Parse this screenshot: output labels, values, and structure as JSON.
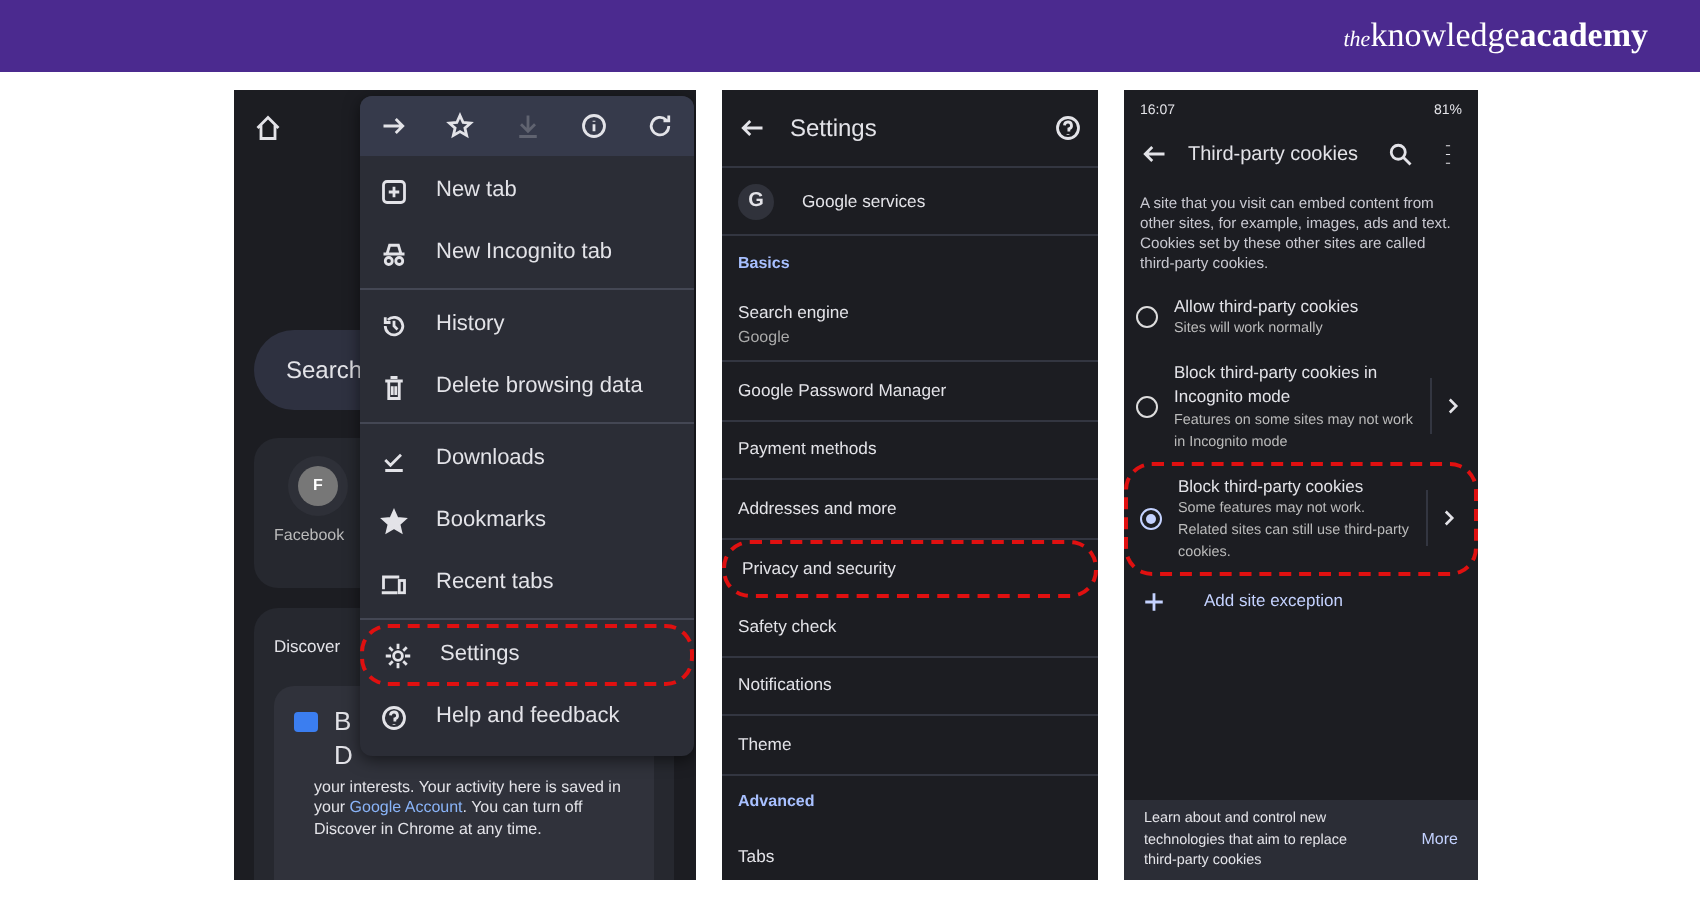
{
  "header": {
    "logo": [
      "the",
      "knowledge",
      "academy"
    ]
  },
  "menu_screen": {
    "search": "Search",
    "shortcut": {
      "letter": "F",
      "label": "Facebook"
    },
    "discover": {
      "title": "Discover",
      "card_letters": [
        "B",
        "D"
      ],
      "text": "your interests. Your activity here is saved in your **Google Account**. You can turn off Discover in Chrome at any time."
    },
    "toolbar": [
      {
        "kind": "forward",
        "disabled": false
      },
      {
        "kind": "star",
        "disabled": false
      },
      {
        "kind": "download",
        "disabled": true
      },
      {
        "kind": "info",
        "disabled": false
      },
      {
        "kind": "refresh",
        "disabled": false
      }
    ],
    "sections": [
      [
        {
          "kind": "new-tab",
          "label": "New tab",
          "highlighted": false
        },
        {
          "kind": "incognito",
          "label": "New Incognito tab",
          "highlighted": false
        }
      ],
      [
        {
          "kind": "history",
          "label": "History",
          "highlighted": false
        },
        {
          "kind": "delete",
          "label": "Delete browsing data",
          "highlighted": false
        }
      ],
      [
        {
          "kind": "downloads",
          "label": "Downloads",
          "highlighted": false
        },
        {
          "kind": "bookmarks",
          "label": "Bookmarks",
          "highlighted": false
        },
        {
          "kind": "recent",
          "label": "Recent tabs",
          "highlighted": false
        }
      ],
      [
        {
          "kind": "settings",
          "label": "Settings",
          "highlighted": true
        },
        {
          "kind": "help",
          "label": "Help and feedback",
          "highlighted": false
        }
      ]
    ]
  },
  "settings_screen": {
    "title": "Settings",
    "items": [
      {
        "kind": "account",
        "letter": "G",
        "label": "Google services",
        "highlighted": false
      },
      {
        "kind": "heading",
        "label": "Basics"
      },
      {
        "kind": "item",
        "label": "Search engine",
        "sub": "Google",
        "highlighted": false
      },
      {
        "kind": "item",
        "label": "Google Password Manager",
        "highlighted": false
      },
      {
        "kind": "item",
        "label": "Payment methods",
        "highlighted": false
      },
      {
        "kind": "item",
        "label": "Addresses and more",
        "highlighted": false
      },
      {
        "kind": "item",
        "label": "Privacy and security",
        "highlighted": true
      },
      {
        "kind": "item",
        "label": "Safety check",
        "highlighted": false
      },
      {
        "kind": "item",
        "label": "Notifications",
        "highlighted": false
      },
      {
        "kind": "item",
        "label": "Theme",
        "highlighted": false
      },
      {
        "kind": "heading",
        "label": "Advanced"
      },
      {
        "kind": "item",
        "label": "Tabs",
        "highlighted": false
      }
    ]
  },
  "cookies_screen": {
    "time": "16:07",
    "battery": "81%",
    "title": "Third-party cookies",
    "description": "A site that you visit can embed content from other sites, for example, images, ads and text. Cookies set by these other sites are called third-party cookies.",
    "options": [
      {
        "title": "Allow third-party cookies",
        "sub": "Sites will work normally",
        "selected": false,
        "expandable": false,
        "highlighted": false
      },
      {
        "title": "Block third-party cookies in Incognito mode",
        "sub": "Features on some sites may not work in Incognito mode",
        "selected": false,
        "expandable": true,
        "highlighted": false
      },
      {
        "title": "Block third-party cookies",
        "sub": "Some features may not work. Related sites can still use third-party cookies.",
        "selected": true,
        "expandable": true,
        "highlighted": true
      }
    ],
    "add_exception": "Add site exception",
    "banner": {
      "text": "Learn about and control new technologies that aim to replace third-party cookies",
      "action": "More"
    }
  }
}
